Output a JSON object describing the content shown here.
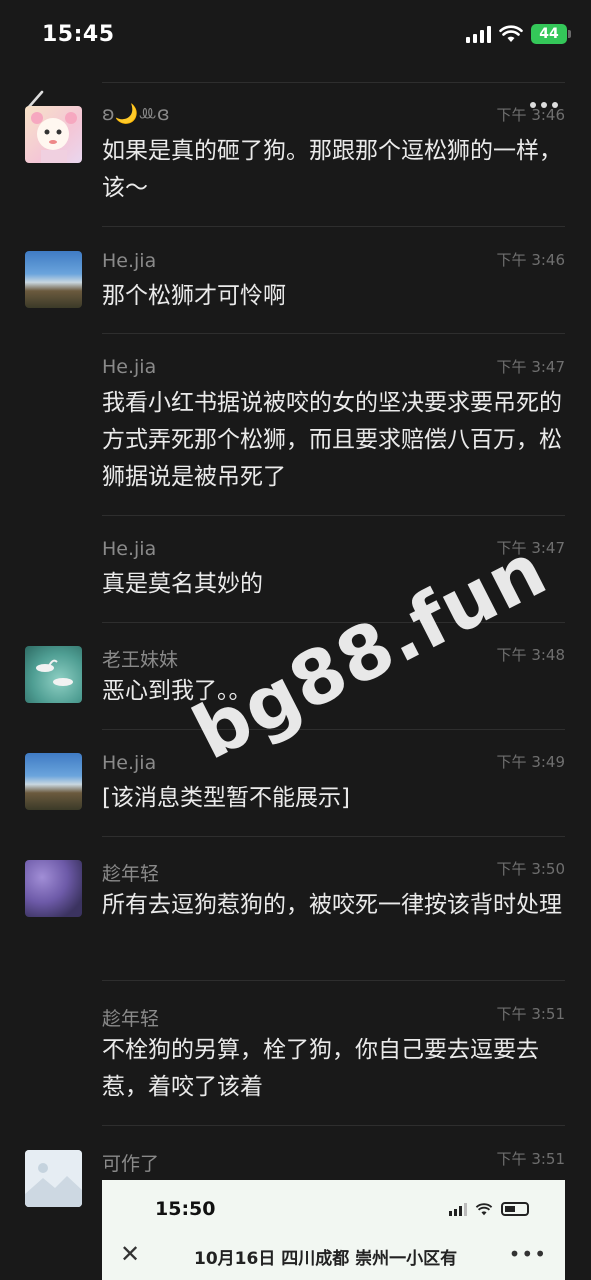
{
  "status_bar": {
    "time": "15:45",
    "battery": "44"
  },
  "messages": [
    {
      "sender": "ʚ🌙ꔛɞ",
      "time": "下午 3:46",
      "text": "如果是真的砸了狗。那跟那个逗松狮的一样，该～",
      "avatar": "cartoon-girl-avatar"
    },
    {
      "sender": "He.jia",
      "time": "下午 3:46",
      "text": "那个松狮才可怜啊",
      "avatar": "seaside-town-avatar"
    },
    {
      "sender": "He.jia",
      "time": "下午 3:47",
      "text": "我看小红书据说被咬的女的坚决要求要吊死的方式弄死那个松狮，而且要求赔偿八百万，松狮据说是被吊死了",
      "avatar": ""
    },
    {
      "sender": "He.jia",
      "time": "下午 3:47",
      "text": "真是莫名其妙的",
      "avatar": ""
    },
    {
      "sender": "老王妹妹",
      "time": "下午 3:48",
      "text": "恶心到我了。。",
      "avatar": "swans-avatar"
    },
    {
      "sender": "He.jia",
      "time": "下午 3:49",
      "text": "[该消息类型暂不能展示]",
      "avatar": "seaside-town-avatar"
    },
    {
      "sender": "趁年轻",
      "time": "下午 3:50",
      "text": "所有去逗狗惹狗的，被咬死一律按该背时处理",
      "avatar": "flower-painting-avatar"
    },
    {
      "sender": "趁年轻",
      "time": "下午 3:51",
      "text": "不栓狗的另算，栓了狗，你自己要去逗要去惹，着咬了该着",
      "avatar": ""
    },
    {
      "sender": "可作了",
      "time": "下午 3:51",
      "text": "",
      "avatar": "image-placeholder-avatar"
    }
  ],
  "embedded_screenshot": {
    "time": "15:50",
    "title": "10月16日 四川成都 崇州一小区有"
  },
  "watermark": "bg88.fun"
}
